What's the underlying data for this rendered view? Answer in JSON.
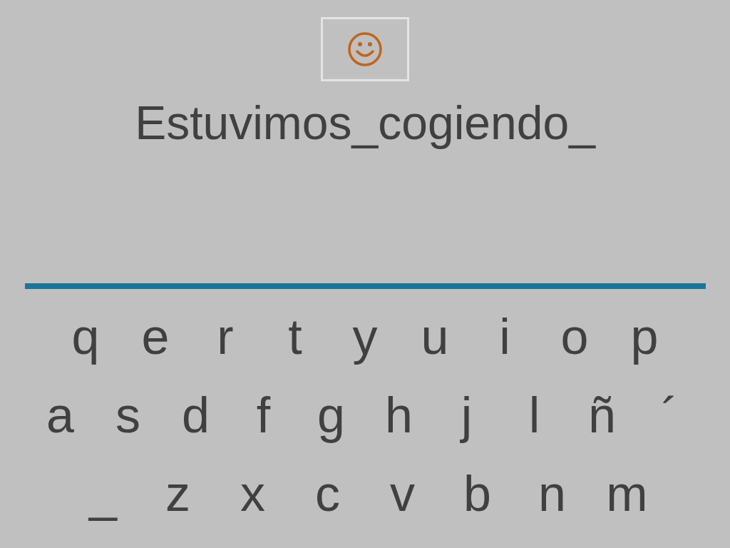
{
  "phrase": "Estuvimos_cogiendo_",
  "keyboard": [
    [
      "q",
      "e",
      "r",
      "t",
      "y",
      "u",
      "i",
      "o",
      "p"
    ],
    [
      "a",
      "s",
      "d",
      "f",
      "g",
      "h",
      "j",
      "l",
      "ñ",
      "´"
    ],
    [
      "_",
      "z",
      "x",
      "c",
      "v",
      "b",
      "n",
      "m"
    ]
  ]
}
